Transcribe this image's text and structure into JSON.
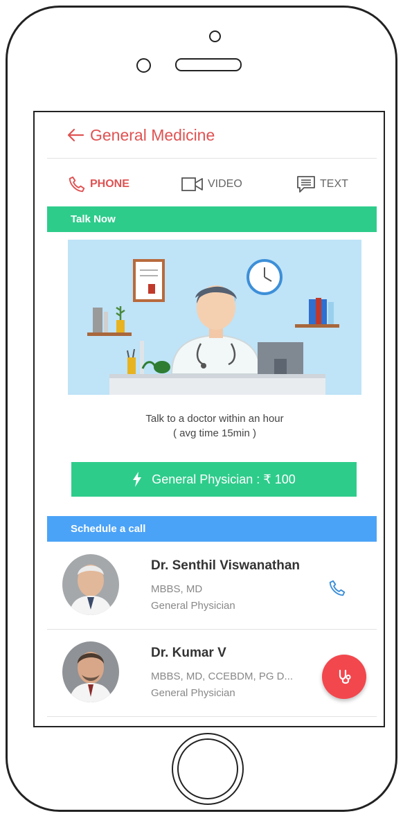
{
  "header": {
    "title": "General Medicine",
    "back_icon": "arrow-left-icon"
  },
  "tabs": [
    {
      "label": "PHONE",
      "icon": "phone-icon",
      "active": true
    },
    {
      "label": "VIDEO",
      "icon": "video-camera-icon",
      "active": false
    },
    {
      "label": "TEXT",
      "icon": "chat-icon",
      "active": false
    }
  ],
  "talk_now": {
    "banner": "Talk Now",
    "description_line1": "Talk to a doctor within an hour",
    "description_line2": "( avg time 15min )",
    "button_label": "General Physician : ₹ 100",
    "button_icon": "lightning-icon"
  },
  "schedule": {
    "banner": "Schedule a call",
    "doctors": [
      {
        "name": "Dr. Senthil Viswanathan",
        "degree": "MBBS, MD",
        "specialty": "General Physician"
      },
      {
        "name": "Dr. Kumar V",
        "degree": "MBBS, MD, CCEBDM, PG D...",
        "specialty": "General Physician"
      }
    ]
  },
  "fab_icon": "stethoscope-icon",
  "colors": {
    "accent_red": "#e05252",
    "green": "#2ecc8b",
    "blue": "#4ba3f7",
    "fab_red": "#f2474d"
  }
}
